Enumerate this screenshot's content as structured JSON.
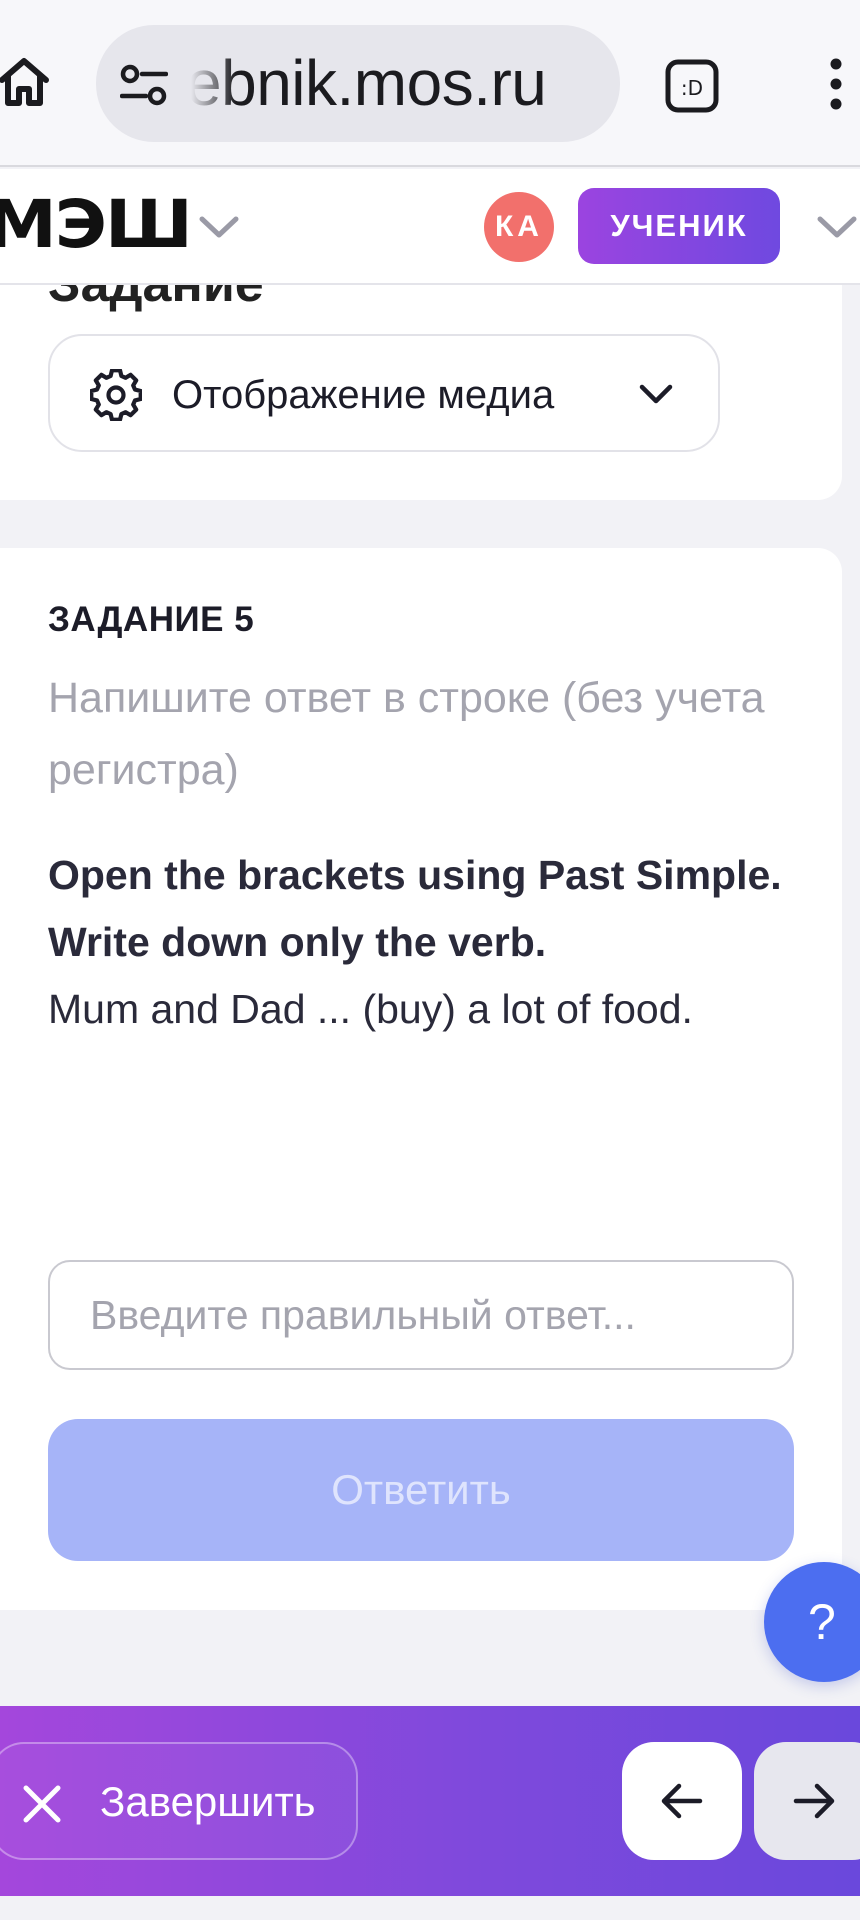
{
  "browser": {
    "url": "ebnik.mos.ru",
    "icons": [
      "home-icon",
      "site-settings-icon",
      "tab-switcher-icon",
      "more-vert-icon"
    ]
  },
  "header": {
    "logo": "МЭШ",
    "avatar_initials": "КА",
    "role_label": "УЧЕНИК",
    "colors": {
      "avatar": "#f2706c",
      "role_gradient": [
        "#9b44e0",
        "#6f49e0"
      ]
    }
  },
  "top_card": {
    "title_partial": "Задание",
    "media_button_label": "Отображение медиа"
  },
  "task": {
    "number_label": "ЗАДАНИЕ 5",
    "hint": "Напишите ответ в строке (без учета регистра)",
    "instruction": "Open the brackets using Past Simple. Write down only the verb.",
    "sentence": "Mum and Dad ... (buy) a lot of food.",
    "answer_value": "",
    "answer_placeholder": "Введите правильный ответ...",
    "submit_label": "Ответить",
    "colors": {
      "submit_bg": "#a6b4f8"
    }
  },
  "help": {
    "label": "?"
  },
  "footer": {
    "finish_label": "Завершить",
    "prev_icon": "arrow-left-icon",
    "next_icon": "arrow-right-icon",
    "colors": {
      "bar_gradient": [
        "#a447dc",
        "#6a48dc"
      ]
    }
  }
}
